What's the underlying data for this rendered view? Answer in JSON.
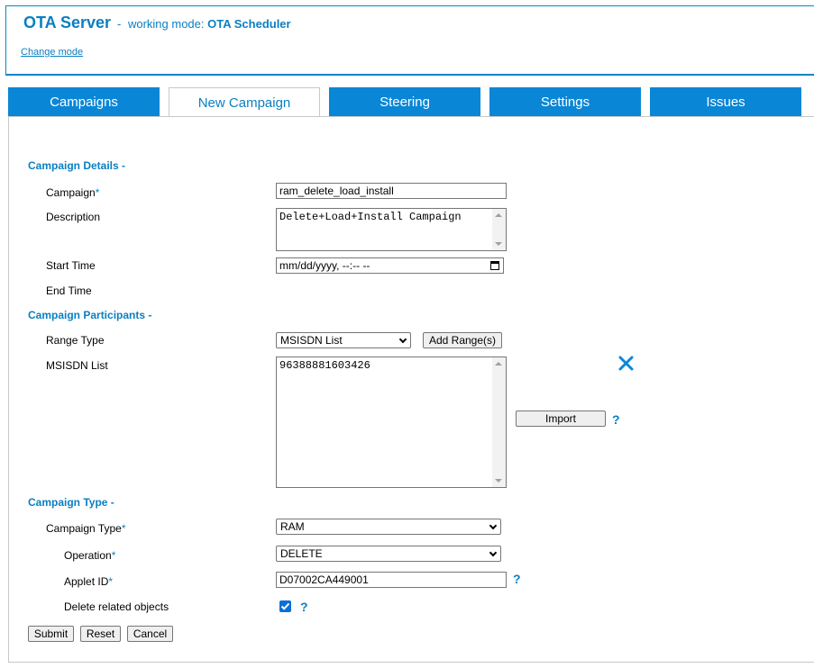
{
  "header": {
    "brand": "OTA Server",
    "separator": "-",
    "mode_prefix": "working mode:",
    "mode_value": "OTA Scheduler",
    "change_mode": "Change mode"
  },
  "tabs": [
    {
      "label": "Campaigns",
      "active": false
    },
    {
      "label": "New Campaign",
      "active": true
    },
    {
      "label": "Steering",
      "active": false
    },
    {
      "label": "Settings",
      "active": false
    },
    {
      "label": "Issues",
      "active": false
    }
  ],
  "sections": {
    "details": "Campaign Details -",
    "participants": "Campaign Participants -",
    "type": "Campaign Type -"
  },
  "fields": {
    "campaign": {
      "label": "Campaign",
      "required": "*",
      "value": "ram_delete_load_install"
    },
    "description": {
      "label": "Description",
      "value": "Delete+Load+Install Campaign"
    },
    "start_time": {
      "label": "Start Time",
      "value": "mm/dd/yyyy, --:-- --"
    },
    "end_time": {
      "label": "End Time"
    },
    "range_type": {
      "label": "Range Type",
      "value": "MSISDN List",
      "add_button": "Add Range(s)"
    },
    "msisdn_list": {
      "label": "MSISDN List",
      "value": "96388881603426",
      "import_button": "Import",
      "help": "?"
    },
    "campaign_type": {
      "label": "Campaign Type",
      "required": "*",
      "value": "RAM"
    },
    "operation": {
      "label": "Operation",
      "required": "*",
      "value": "DELETE"
    },
    "applet_id": {
      "label": "Applet ID",
      "required": "*",
      "value": "D07002CA449001",
      "help": "?"
    },
    "delete_related": {
      "label": "Delete related objects",
      "checked": true,
      "help": "?"
    }
  },
  "actions": {
    "submit": "Submit",
    "reset": "Reset",
    "cancel": "Cancel"
  },
  "colors": {
    "brand": "#0a7fc1",
    "tab_bg": "#0a86d6",
    "checkbox": "#0a6fd8"
  }
}
